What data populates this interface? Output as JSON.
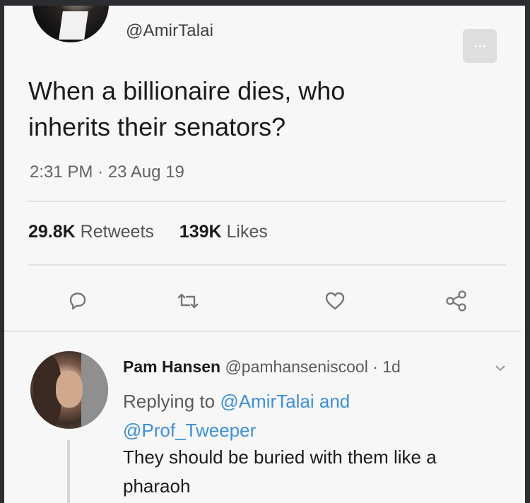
{
  "tweet": {
    "handle": "@AmirTalai",
    "text": "When a billionaire dies, who\ninherits their senators?",
    "time": "2:31 PM",
    "date": "23 Aug 19",
    "retweets_count": "29.8K",
    "retweets_label": "Retweets",
    "likes_count": "139K",
    "likes_label": "Likes"
  },
  "actions": {
    "icons": [
      "reply-icon",
      "retweet-icon",
      "like-icon",
      "share-icon"
    ]
  },
  "reply": {
    "name": "Pam Hansen",
    "handle": "@pamhanseniscool",
    "age": "1d",
    "replying_prefix": "Replying to",
    "mention_1": "@AmirTalai",
    "and_word": "and",
    "mention_2": "@Prof_Tweeper",
    "text": "They should be buried with them like a\npharaoh"
  },
  "colors": {
    "background": "#2b2d31",
    "card": "#f7f7f7",
    "link": "#3d8fd6",
    "icon": "#777777"
  }
}
